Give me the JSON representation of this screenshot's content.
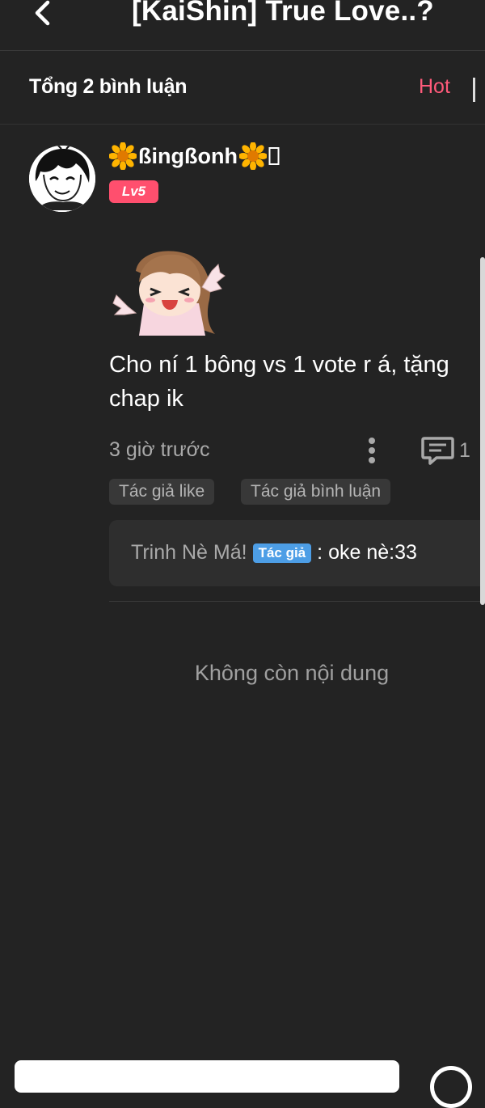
{
  "header": {
    "title": "[KaiShin] True Love..?",
    "back_icon": "chevron-left-icon"
  },
  "comments_bar": {
    "total_label": "Tổng 2 bình luận",
    "sort_label": "Hot",
    "sort_color": "#ff5a7a"
  },
  "comment": {
    "username": "ßingßonh",
    "username_icons": [
      "sunflower-icon",
      "sunflower-icon",
      "unknown-glyph"
    ],
    "level": "Lv5",
    "level_color": "#ff4f6e",
    "sticker": "anime-girl-cheering-sticker",
    "text_line1": "Cho ní 1 bông vs 1 vote r á, tặng",
    "text_line2": "chap ik",
    "time": "3 giờ trước",
    "reply_count": "1",
    "tags": [
      "Tác giả like",
      "Tác giả bình luận"
    ],
    "reply": {
      "author": "Trinh Nè Má!",
      "badge": "Tác giả",
      "badge_color": "#4d9ee6",
      "separator": " : ",
      "content": "oke nè:33"
    }
  },
  "end_message": "Không còn nội dung",
  "bottom_bar": {
    "input_placeholder": "",
    "emoji_icon": "emoji-icon"
  }
}
